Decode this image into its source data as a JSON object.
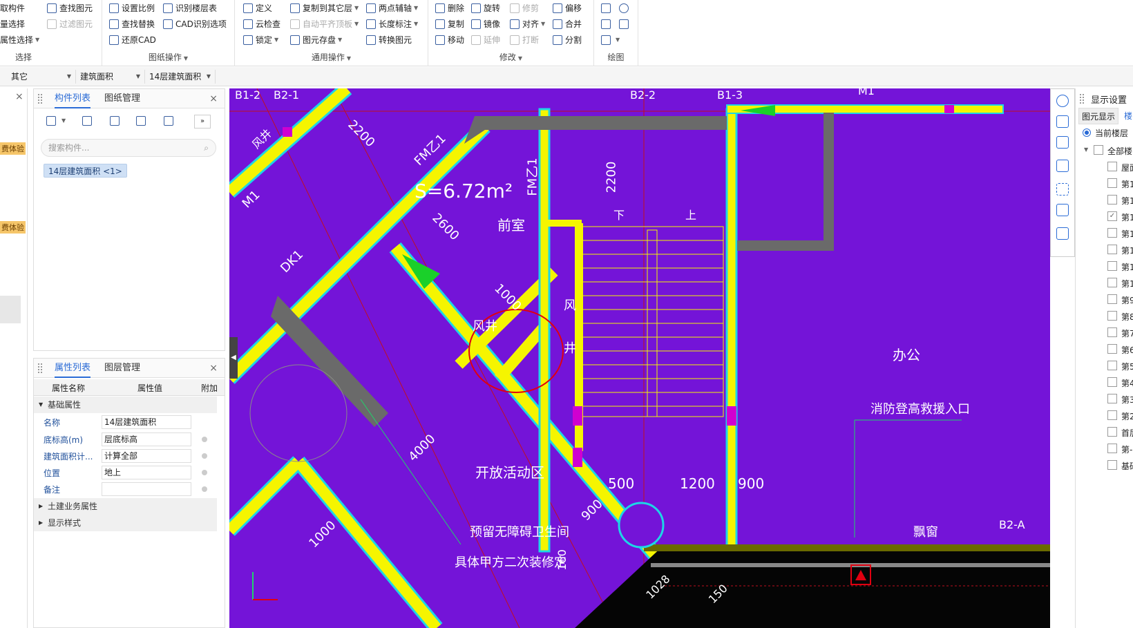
{
  "ribbon": {
    "select_group": {
      "btn1": "取构件",
      "btn2": "量选择",
      "btn3": "属性选择",
      "caption": "选择"
    },
    "drawing_group": {
      "find": "查找图元",
      "filter": "过滤图元",
      "set_scale": "设置比例",
      "find_replace": "查找替换",
      "restore_cad": "还原CAD",
      "identify_floor": "识别楼层表",
      "cad_options": "CAD识别选项",
      "caption": "图纸操作"
    },
    "general_group": {
      "define": "定义",
      "cloud_check": "云检查",
      "lock": "锁定",
      "copy_to_floor": "复制到其它层",
      "auto_align": "自动平齐顶板",
      "save_elem": "图元存盘",
      "two_point_aux": "两点辅轴",
      "length_mark": "长度标注",
      "convert_elem": "转换图元",
      "caption": "通用操作"
    },
    "modify_group": {
      "delete": "删除",
      "copy": "复制",
      "move": "移动",
      "rotate": "旋转",
      "mirror": "镜像",
      "extend": "延伸",
      "trim": "修剪",
      "align": "对齐",
      "break": "打断",
      "offset": "偏移",
      "merge": "合并",
      "split": "分割",
      "caption": "修改"
    },
    "draw_group": {
      "caption": "绘图"
    }
  },
  "toolbar2": {
    "combo1": "其它",
    "combo2": "建筑面积",
    "combo3": "14层建筑面积"
  },
  "left_strip": {
    "badge1": "费体验",
    "badge2": "费体验"
  },
  "component_panel": {
    "tab1": "构件列表",
    "tab2": "图纸管理",
    "search_placeholder": "搜索构件...",
    "item": "14层建筑面积 <1>"
  },
  "property_panel": {
    "tab1": "属性列表",
    "tab2": "图层管理",
    "col_name": "属性名称",
    "col_value": "属性值",
    "col_extra": "附加",
    "section_basic": "基础属性",
    "rows": [
      {
        "k": "名称",
        "v": "14层建筑面积"
      },
      {
        "k": "底标高(m)",
        "v": "层底标高"
      },
      {
        "k": "建筑面积计...",
        "v": "计算全部"
      },
      {
        "k": "位置",
        "v": "地上"
      },
      {
        "k": "备注",
        "v": ""
      }
    ],
    "section_civil": "土建业务属性",
    "section_style": "显示样式"
  },
  "canvas": {
    "axes": [
      "B1-2",
      "B2-1",
      "B2-2",
      "B1-3",
      "M1"
    ],
    "area_label": "S=6.72m²",
    "dims": [
      "2200",
      "2600",
      "1000",
      "2200",
      "4000",
      "500",
      "1200",
      "900",
      "900",
      "1000",
      "160",
      "1028",
      "150"
    ],
    "rooms": [
      "前室",
      "风井",
      "风",
      "井",
      "开放活动区",
      "办公",
      "消防登高救援入口",
      "预留无障碍卫生间",
      "具体甲方二次装修定",
      "飘窗"
    ],
    "door_labels": [
      "FM乙1",
      "FM乙1",
      "M1",
      "DK1",
      "风井"
    ],
    "stair": [
      "下",
      "上"
    ],
    "grid_b2a": "B2-A"
  },
  "right_panel": {
    "title": "显示设置",
    "tab1": "图元显示",
    "tab2": "楼",
    "current_floor": "当前楼层",
    "all_floors": "全部楼",
    "floors": [
      "屋面",
      "第1",
      "第1",
      "第1",
      "第1",
      "第1",
      "第1",
      "第1",
      "第9",
      "第8",
      "第7",
      "第6",
      "第5",
      "第4",
      "第3",
      "第2",
      "首层",
      "第-",
      "基础"
    ]
  }
}
